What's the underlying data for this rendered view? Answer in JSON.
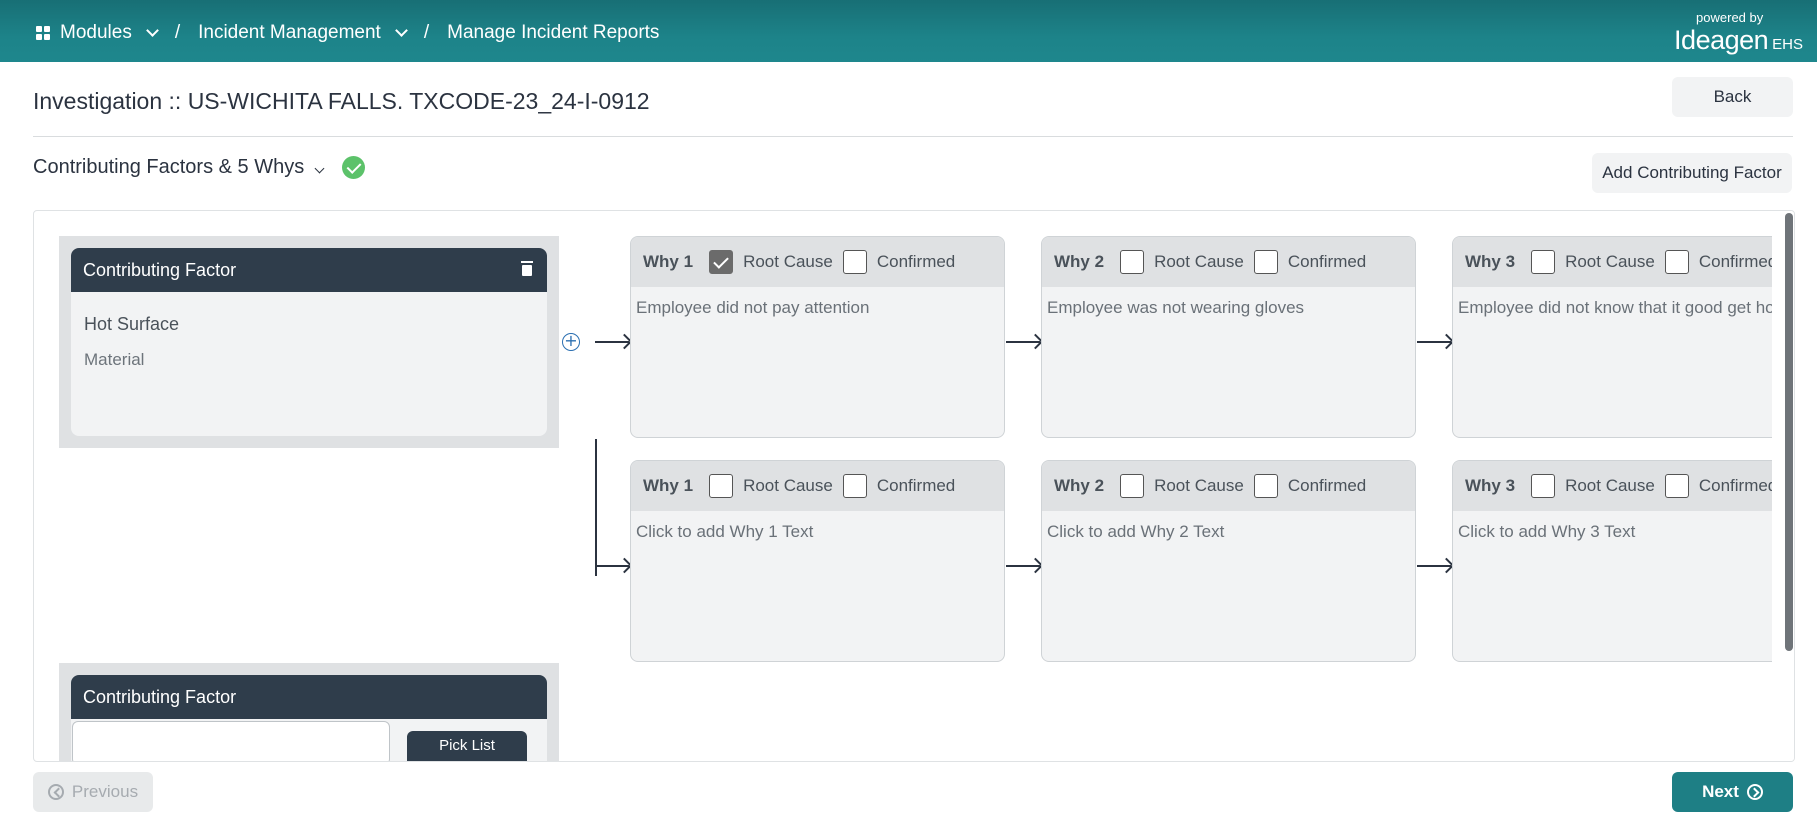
{
  "breadcrumb": {
    "modules": "Modules",
    "incident_management": "Incident Management",
    "manage_reports": "Manage Incident Reports",
    "separator": "/"
  },
  "brand": {
    "powered_by": "powered by",
    "logo": "Ideagen",
    "suffix": "EHS"
  },
  "header": {
    "title": "Investigation ::  US-WICHITA FALLS. TXCODE-23_24-I-0912",
    "back_label": "Back"
  },
  "section": {
    "title": "Contributing Factors & 5 Whys",
    "add_label": "Add Contributing Factor"
  },
  "factors": [
    {
      "header": "Contributing Factor",
      "name": "Hot Surface",
      "category": "Material",
      "whys": [
        [
          {
            "label": "Why 1",
            "root_cause": true,
            "confirmed": false,
            "text": "Employee did not pay attention"
          },
          {
            "label": "Why 2",
            "root_cause": false,
            "confirmed": false,
            "text": "Employee was not wearing gloves"
          },
          {
            "label": "Why 3",
            "root_cause": false,
            "confirmed": false,
            "text": "Employee did not know that it good get hot"
          }
        ],
        [
          {
            "label": "Why 1",
            "root_cause": false,
            "confirmed": false,
            "text": "Click to add Why 1 Text"
          },
          {
            "label": "Why 2",
            "root_cause": false,
            "confirmed": false,
            "text": "Click to add Why 2 Text"
          },
          {
            "label": "Why 3",
            "root_cause": false,
            "confirmed": false,
            "text": "Click to add Why 3 Text"
          }
        ]
      ]
    },
    {
      "header": "Contributing Factor",
      "pick_list_label": "Pick List"
    }
  ],
  "labels": {
    "root_cause": "Root Cause",
    "confirmed": "Confirmed"
  },
  "footer": {
    "previous_label": "Previous",
    "next_label": "Next"
  },
  "colors": {
    "topbar": "#1e878d",
    "factor_header": "#2f3d4b",
    "next_button": "#1e7f85",
    "success": "#5cc26a"
  }
}
